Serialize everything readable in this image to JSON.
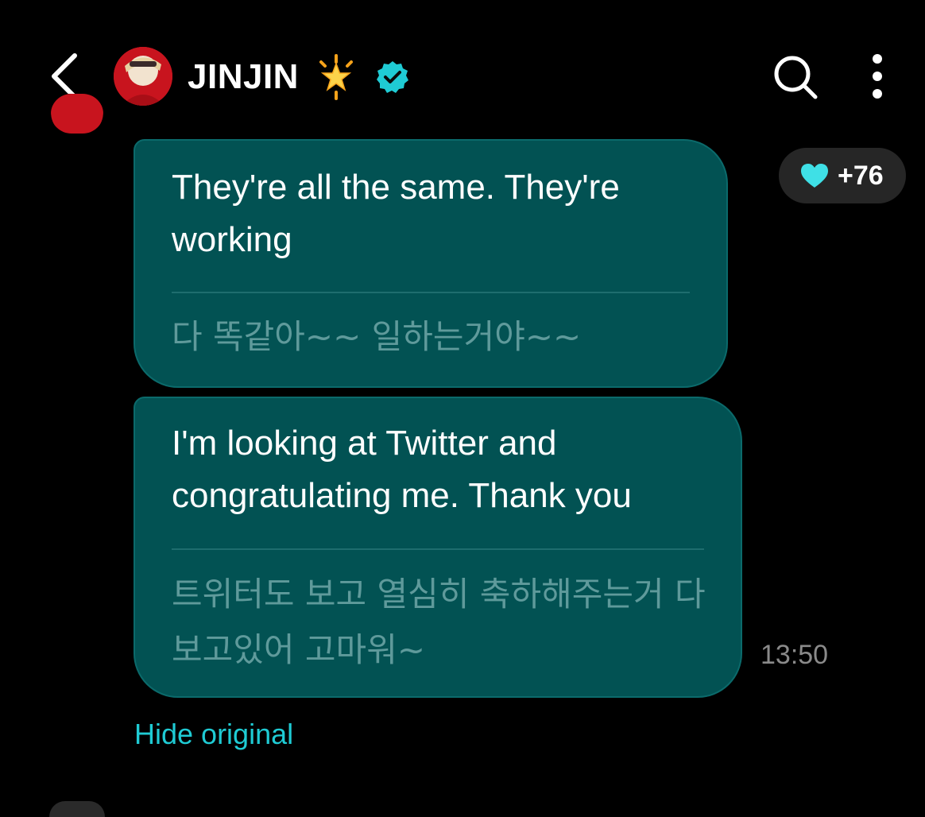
{
  "header": {
    "title": "JINJIN",
    "back_icon": "chevron-left-icon",
    "star_icon": "glowing-star-emoji",
    "verified_icon": "verified-badge-icon",
    "search_icon": "search-icon",
    "more_icon": "more-vertical-icon"
  },
  "messages": [
    {
      "translated": "They're all the same. They're working",
      "original": "다 똑같아~~ 일하는거야~~"
    },
    {
      "translated": "I'm looking at Twitter and congratulating me. Thank you",
      "original": "트위터도 보고 열심히 축하해주는거 다 보고있어 고마워~"
    }
  ],
  "reaction": {
    "icon": "heart-icon",
    "count": "+76"
  },
  "timestamp": "13:50",
  "hide_original_label": "Hide original",
  "colors": {
    "background": "#000000",
    "bubble": "#025253",
    "accent": "#1fcbd4",
    "original_text": "#5f9a9b"
  }
}
